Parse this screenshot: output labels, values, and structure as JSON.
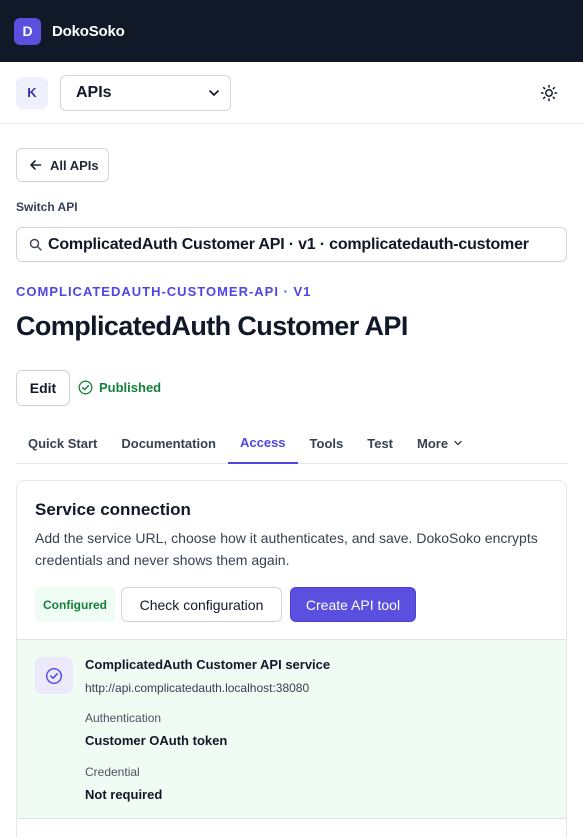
{
  "app": {
    "logo_letter": "D",
    "name": "DokoSoko"
  },
  "workspace": {
    "avatar_letter": "K",
    "selected_section": "APIs"
  },
  "nav": {
    "back_label": "All APIs"
  },
  "switch_api": {
    "label": "Switch API",
    "value": "ComplicatedAuth Customer API · v1 · complicatedauth-customer"
  },
  "api": {
    "eyebrow": "COMPLICATEDAUTH-CUSTOMER-API · V1",
    "title": "ComplicatedAuth Customer API",
    "edit_label": "Edit",
    "status": "Published"
  },
  "tabs": [
    {
      "label": "Quick Start"
    },
    {
      "label": "Documentation"
    },
    {
      "label": "Access",
      "active": true
    },
    {
      "label": "Tools"
    },
    {
      "label": "Test"
    },
    {
      "label": "More"
    }
  ],
  "connection": {
    "title": "Service connection",
    "description": "Add the service URL, choose how it authenticates, and save. DokoSoko encrypts credentials and never shows them again.",
    "badge": "Configured",
    "check_label": "Check configuration",
    "create_label": "Create API tool",
    "service": {
      "name": "ComplicatedAuth Customer API service",
      "url": "http://api.complicatedauth.localhost:38080",
      "auth_label": "Authentication",
      "auth_value": "Customer OAuth token",
      "credential_label": "Credential",
      "credential_value": "Not required"
    }
  },
  "colors": {
    "accent": "#5b4fe0",
    "topbar": "#111827",
    "success": "#15803d",
    "service_bg": "#effbf3"
  },
  "icons": [
    "arrow-left-icon",
    "search-icon",
    "chevron-down-icon",
    "sun-icon",
    "check-circle-icon"
  ]
}
